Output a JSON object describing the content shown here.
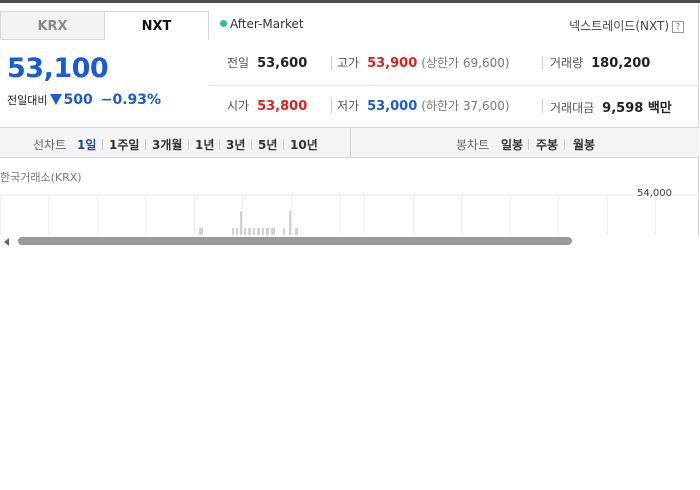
{
  "tabs": [
    {
      "label": "KRX",
      "active": false
    },
    {
      "label": "NXT",
      "active": true
    }
  ],
  "session": {
    "label": "After-Market",
    "dot_color": "#2bc28d"
  },
  "nxt_link": {
    "label": "넥스트레이드(NXT)",
    "help": "?"
  },
  "price": {
    "current": "53,100",
    "change_label": "전일대비",
    "change_value": "500",
    "change_rate": "−0.93%",
    "direction": "down",
    "color": "#1a5bd6"
  },
  "stats": {
    "prev_close": {
      "label": "전일",
      "value": "53,600"
    },
    "high": {
      "label": "고가",
      "value": "53,900",
      "sub": "(상한가 69,600)"
    },
    "volume": {
      "label": "거래량",
      "value": "180,200"
    },
    "open": {
      "label": "시가",
      "value": "53,800"
    },
    "low": {
      "label": "저가",
      "value": "53,000",
      "sub": "(하한가 37,600)"
    },
    "amount": {
      "label": "거래대금",
      "value": "9,598 백만"
    }
  },
  "period": {
    "line_label": "선차트",
    "line_items": [
      "1일",
      "1주일",
      "3개월",
      "1년",
      "3년",
      "5년",
      "10년"
    ],
    "active_index": 0,
    "candle_label": "봉차트",
    "candle_items": [
      "일봉",
      "주봉",
      "월봉"
    ]
  },
  "chart": {
    "exchange_label": "한국거래소(KRX)",
    "y_tick": "54,000"
  }
}
